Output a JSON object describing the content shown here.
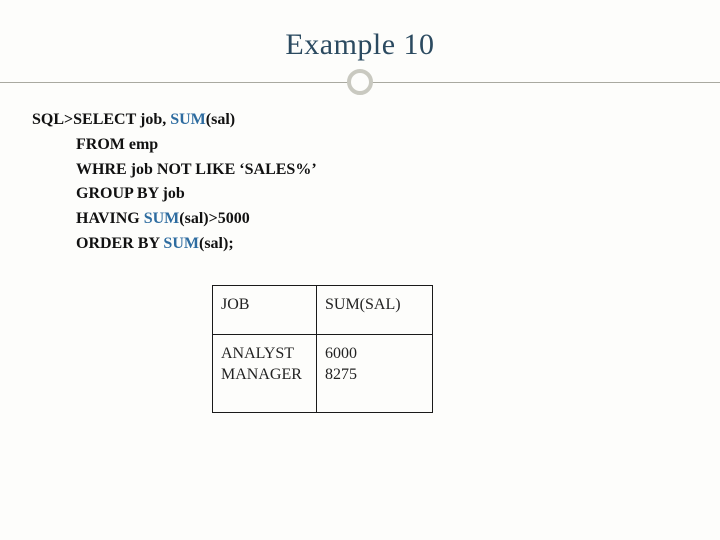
{
  "title": "Example 10",
  "sql": {
    "l1_pre": "SQL>SELECT  job, ",
    "l1_fn": "SUM",
    "l1_post": "(sal)",
    "l2": "FROM  emp",
    "l3": "WHRE job NOT LIKE ‘SALES%’",
    "l4": "GROUP BY job",
    "l5_pre": "HAVING ",
    "l5_fn": "SUM",
    "l5_post": "(sal)>5000",
    "l6_pre": "ORDER BY ",
    "l6_fn": "SUM",
    "l6_post": "(sal);"
  },
  "table": {
    "headers": {
      "c1": "JOB",
      "c2": "SUM(SAL)"
    },
    "col1": "ANALYST\nMANAGER",
    "col2": "6000\n8275"
  }
}
